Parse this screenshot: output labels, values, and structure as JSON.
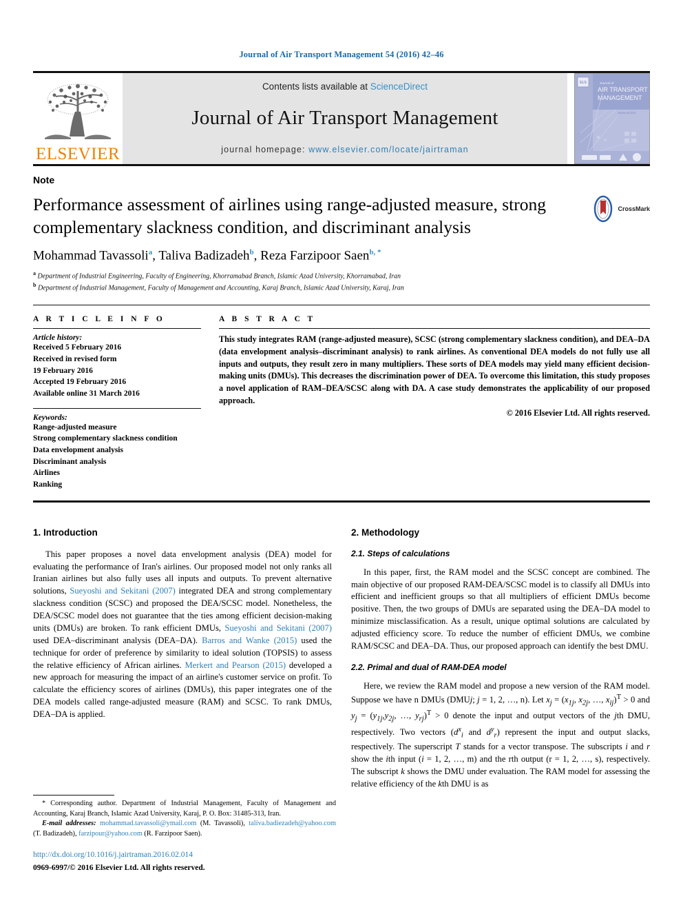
{
  "running_head": "Journal of Air Transport Management 54 (2016) 42–46",
  "masthead": {
    "publisher_logo_text": "ELSEVIER",
    "contents_prefix": "Contents lists available at ",
    "contents_link": "ScienceDirect",
    "journal_name": "Journal of Air Transport Management",
    "homepage_prefix": "journal homepage: ",
    "homepage_url": "www.elsevier.com/locate/jairtraman",
    "cover_line1": "Journal of",
    "cover_line2": "AIR TRANSPORT",
    "cover_line3": "MANAGEMENT"
  },
  "article": {
    "doc_type": "Note",
    "title": "Performance assessment of airlines using range-adjusted measure, strong complementary slackness condition, and discriminant analysis",
    "crossmark_label": "CrossMark",
    "authors": [
      {
        "name": "Mohammad Tavassoli",
        "marks": "a"
      },
      {
        "name": "Taliva Badizadeh",
        "marks": "b"
      },
      {
        "name": "Reza Farzipoor Saen",
        "marks": "b, *"
      }
    ],
    "affiliations": [
      {
        "mark": "a",
        "text": "Department of Industrial Engineering, Faculty of Engineering, Khorramabad Branch, Islamic Azad University, Khorramabad, Iran"
      },
      {
        "mark": "b",
        "text": "Department of Industrial Management, Faculty of Management and Accounting, Karaj Branch, Islamic Azad University, Karaj, Iran"
      }
    ]
  },
  "article_info": {
    "heading": "A R T I C L E   I N F O",
    "history_title": "Article history:",
    "history": [
      "Received 5 February 2016",
      "Received in revised form",
      "19 February 2016",
      "Accepted 19 February 2016",
      "Available online 31 March 2016"
    ],
    "keywords_title": "Keywords:",
    "keywords": [
      "Range-adjusted measure",
      "Strong complementary slackness condition",
      "Data envelopment analysis",
      "Discriminant analysis",
      "Airlines",
      "Ranking"
    ]
  },
  "abstract": {
    "heading": "A B S T R A C T",
    "text": "This study integrates RAM (range-adjusted measure), SCSC (strong complementary slackness condition), and DEA–DA (data envelopment analysis–discriminant analysis) to rank airlines. As conventional DEA models do not fully use all inputs and outputs, they result zero in many multipliers. These sorts of DEA models may yield many efficient decision-making units (DMUs). This decreases the discrimination power of DEA. To overcome this limitation, this study proposes a novel application of RAM–DEA/SCSC along with DA. A case study demonstrates the applicability of our proposed approach.",
    "copyright": "© 2016 Elsevier Ltd. All rights reserved."
  },
  "sections": {
    "introduction": {
      "heading": "1. Introduction",
      "para_parts": [
        {
          "type": "text",
          "value": "This paper proposes a novel data envelopment analysis (DEA) model for evaluating the performance of Iran's airlines. Our proposed model not only ranks all Iranian airlines but also fully uses all inputs and outputs. To prevent alternative solutions, "
        },
        {
          "type": "link",
          "value": "Sueyoshi and Sekitani (2007)"
        },
        {
          "type": "text",
          "value": " integrated DEA and strong complementary slackness condition (SCSC) and proposed the DEA/SCSC model. Nonetheless, the DEA/SCSC model does not guarantee that the ties among efficient decision-making units (DMUs) are broken. To rank efficient DMUs, "
        },
        {
          "type": "link",
          "value": "Sueyoshi and Sekitani (2007)"
        },
        {
          "type": "text",
          "value": " used DEA–discriminant analysis (DEA–DA). "
        },
        {
          "type": "link",
          "value": "Barros and Wanke (2015)"
        },
        {
          "type": "text",
          "value": " used the technique for order of preference by similarity to ideal solution (TOPSIS) to assess the relative efficiency of African airlines. "
        },
        {
          "type": "link",
          "value": "Merkert and Pearson (2015)"
        },
        {
          "type": "text",
          "value": " developed a new approach for measuring the impact of an airline's customer service on profit. To calculate the efficiency scores of airlines (DMUs), this paper integrates one of the DEA models called range-adjusted measure (RAM) and SCSC. To rank DMUs, DEA–DA is applied."
        }
      ]
    },
    "methodology": {
      "heading": "2. Methodology",
      "sub1_heading": "2.1. Steps of calculations",
      "sub1_para": "In this paper, first, the RAM model and the SCSC concept are combined. The main objective of our proposed RAM-DEA/SCSC model is to classify all DMUs into efficient and inefficient groups so that all multipliers of efficient DMUs become positive. Then, the two groups of DMUs are separated using the DEA–DA model to minimize misclassification. As a result, unique optimal solutions are calculated by adjusted efficiency score. To reduce the number of efficient DMUs, we combine RAM/SCSC and DEA–DA. Thus, our proposed approach can identify the best DMU.",
      "sub2_heading": "2.2. Primal and dual of RAM-DEA model",
      "sub2_para_plain": "Here, we review the RAM model and propose a new version of the RAM model. Suppose we have n DMUs (DMUj; j = 1, 2, …, n). Let xj = (x1j, x2j, …, xij)T > 0 and yj = (y1j, y2j, …, yrj)T > 0 denote the input and output vectors of the jth DMU, respectively. Two vectors (dix and dry) represent the input and output slacks, respectively. The superscript T stands for a vector transpose. The subscripts i and r show the ith input (i = 1, 2, …, m) and the rth output (r = 1, 2, …, s), respectively. The subscript k shows the DMU under evaluation. The RAM model for assessing the relative efficiency of the kth DMU is as"
    }
  },
  "footnote": {
    "corresponding": "* Corresponding author. Department of Industrial Management, Faculty of Management and Accounting, Karaj Branch, Islamic Azad University, Karaj, P. O. Box: 31485-313, Iran.",
    "email_label": "E-mail addresses:",
    "emails": [
      {
        "address": "mohammad.tavassoli@ymail.com",
        "owner": "(M. Tavassoli)"
      },
      {
        "address": "taliva.badiezadeh@yahoo.com",
        "owner": "(T. Badizadeh)"
      },
      {
        "address": "farzipour@yahoo.com",
        "owner": "(R. Farzipoor Saen)"
      }
    ],
    "doi": "http://dx.doi.org/10.1016/j.jairtraman.2016.02.014",
    "issn": "0969-6997/© 2016 Elsevier Ltd. All rights reserved."
  },
  "colors": {
    "link": "#2d7fb8",
    "running_head": "#1a6ba8",
    "elsevier_orange": "#F08000",
    "band_gray": "#e4e4e4"
  }
}
